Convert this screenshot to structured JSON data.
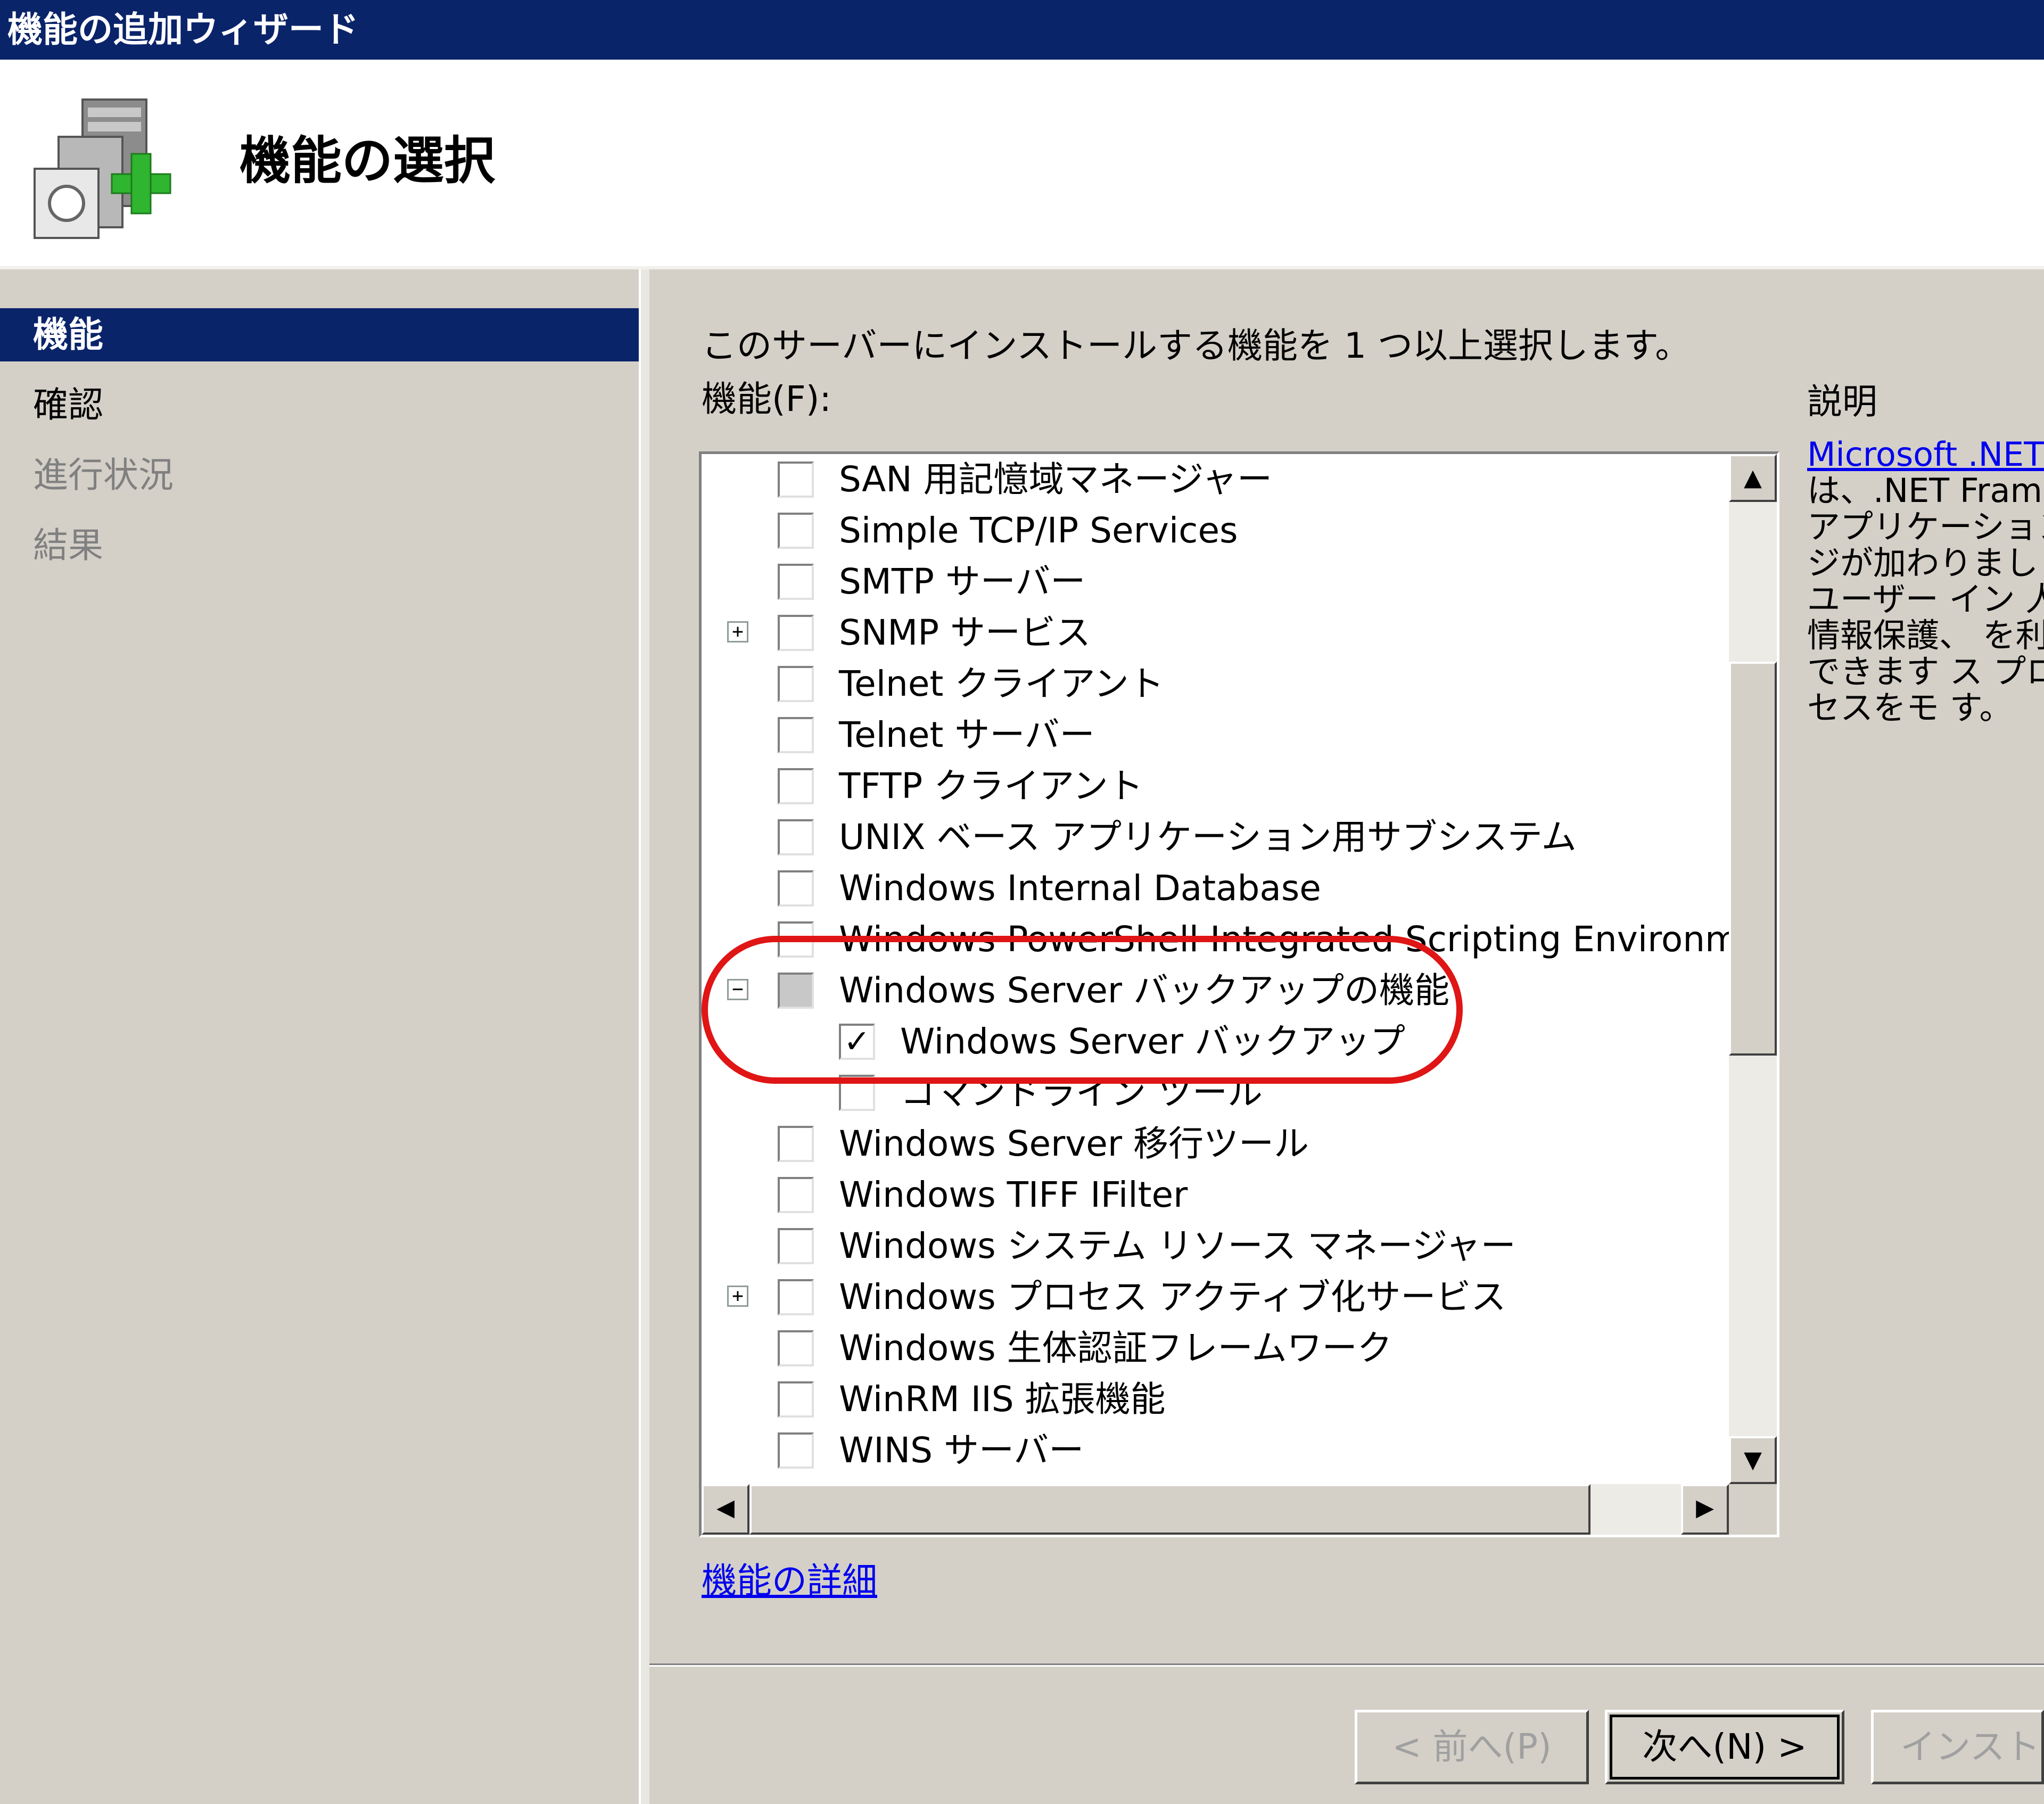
{
  "window": {
    "title": "機能の追加ウィザード"
  },
  "header": {
    "page_title": "機能の選択"
  },
  "sidebar": {
    "items": [
      {
        "label": "機能",
        "state": "active"
      },
      {
        "label": "確認",
        "state": "normal"
      },
      {
        "label": "進行状況",
        "state": "disabled"
      },
      {
        "label": "結果",
        "state": "disabled"
      }
    ]
  },
  "main": {
    "intro": "このサーバーにインストールする機能を 1 つ以上選択します。",
    "features_label": "機能(F):",
    "description_label": "説明",
    "description_link": "Microsoft .NET",
    "description_text": "は、.NET Frame アプリケーション ジが加わりまし なユーザー イン 人情報保護、 を利用できます ス プロセスをモ す。",
    "features": [
      {
        "label": "SAN 用記憶域マネージャー",
        "checked": "unchecked",
        "expander": "",
        "level": 0
      },
      {
        "label": "Simple TCP/IP Services",
        "checked": "unchecked",
        "expander": "",
        "level": 0
      },
      {
        "label": "SMTP サーバー",
        "checked": "unchecked",
        "expander": "",
        "level": 0
      },
      {
        "label": "SNMP サービス",
        "checked": "unchecked",
        "expander": "+",
        "level": 0
      },
      {
        "label": "Telnet クライアント",
        "checked": "unchecked",
        "expander": "",
        "level": 0
      },
      {
        "label": "Telnet サーバー",
        "checked": "unchecked",
        "expander": "",
        "level": 0
      },
      {
        "label": "TFTP クライアント",
        "checked": "unchecked",
        "expander": "",
        "level": 0
      },
      {
        "label": "UNIX ベース アプリケーション用サブシステム",
        "checked": "unchecked",
        "expander": "",
        "level": 0
      },
      {
        "label": "Windows Internal Database",
        "checked": "unchecked",
        "expander": "",
        "level": 0
      },
      {
        "label": "Windows PowerShell Integrated Scripting Environment",
        "checked": "unchecked",
        "expander": "",
        "level": 0
      },
      {
        "label": "Windows Server バックアップの機能",
        "checked": "mixed",
        "expander": "−",
        "level": 0
      },
      {
        "label": "Windows Server バックアップ",
        "checked": "checked",
        "expander": "",
        "level": 1
      },
      {
        "label": "コマンドライン ツール",
        "checked": "unchecked",
        "expander": "",
        "level": 1
      },
      {
        "label": "Windows Server 移行ツール",
        "checked": "unchecked",
        "expander": "",
        "level": 0
      },
      {
        "label": "Windows TIFF IFilter",
        "checked": "unchecked",
        "expander": "",
        "level": 0
      },
      {
        "label": "Windows システム リソース マネージャー",
        "checked": "unchecked",
        "expander": "",
        "level": 0
      },
      {
        "label": "Windows プロセス アクティブ化サービス",
        "checked": "unchecked",
        "expander": "+",
        "level": 0
      },
      {
        "label": "Windows 生体認証フレームワーク",
        "checked": "unchecked",
        "expander": "",
        "level": 0
      },
      {
        "label": "WinRM IIS 拡張機能",
        "checked": "unchecked",
        "expander": "",
        "level": 0
      },
      {
        "label": "WINS サーバー",
        "checked": "unchecked",
        "expander": "",
        "level": 0
      }
    ],
    "details_link": "機能の詳細"
  },
  "buttons": {
    "back": "< 前へ(P)",
    "next": "次へ(N) >",
    "install": "インストール"
  },
  "icons": {
    "scroll_up": "▲",
    "scroll_down": "▼",
    "scroll_left": "◀",
    "scroll_right": "▶",
    "check": "✓"
  },
  "colors": {
    "title_bar": "#0a246a",
    "highlight_circle": "#e01515",
    "link": "#0000ee"
  }
}
